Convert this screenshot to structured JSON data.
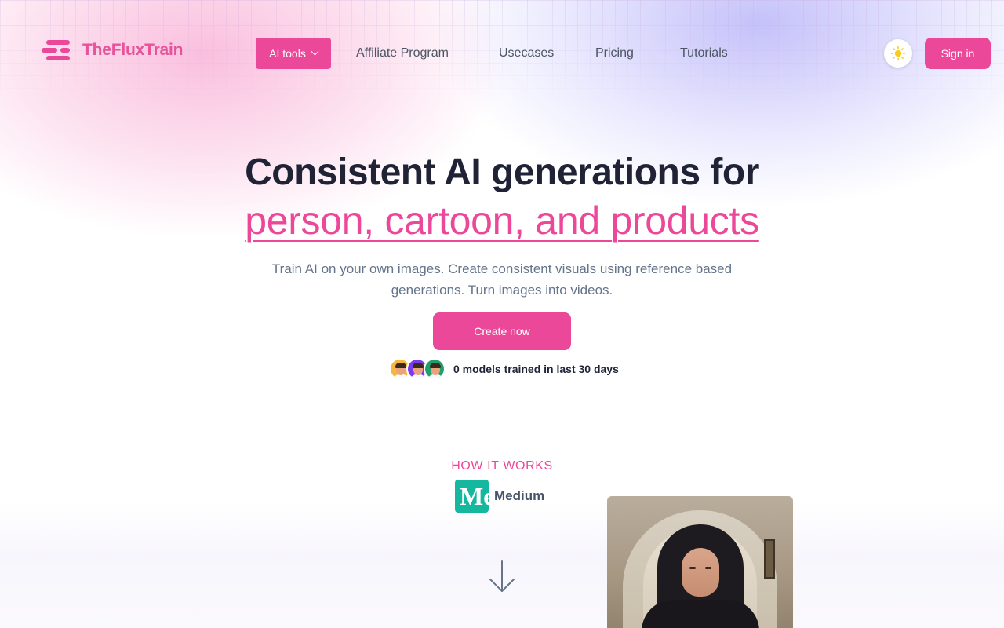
{
  "brand": {
    "name": "TheFluxTrain"
  },
  "nav": {
    "ai_tools": "AI tools",
    "affiliate": "Affiliate Program",
    "usecases": "Usecases",
    "pricing": "Pricing",
    "tutorials": "Tutorials"
  },
  "header": {
    "theme_icon": "sun-icon",
    "signin": "Sign in"
  },
  "hero": {
    "title_line1": "Consistent AI generations for",
    "title_line2": "person, cartoon, and products",
    "subtitle": "Train AI on your own images. Create consistent visuals using reference based generations. Turn images into videos.",
    "cta": "Create now",
    "trained_text": "0 models trained in last 30 days"
  },
  "how_it_works": {
    "heading": "HOW IT WORKS",
    "source_icon_text": "Me",
    "source_name": "Medium"
  },
  "colors": {
    "accent": "#ec4899",
    "text": "#1f2335",
    "muted": "#64748b",
    "medium_green": "#15b79e"
  }
}
